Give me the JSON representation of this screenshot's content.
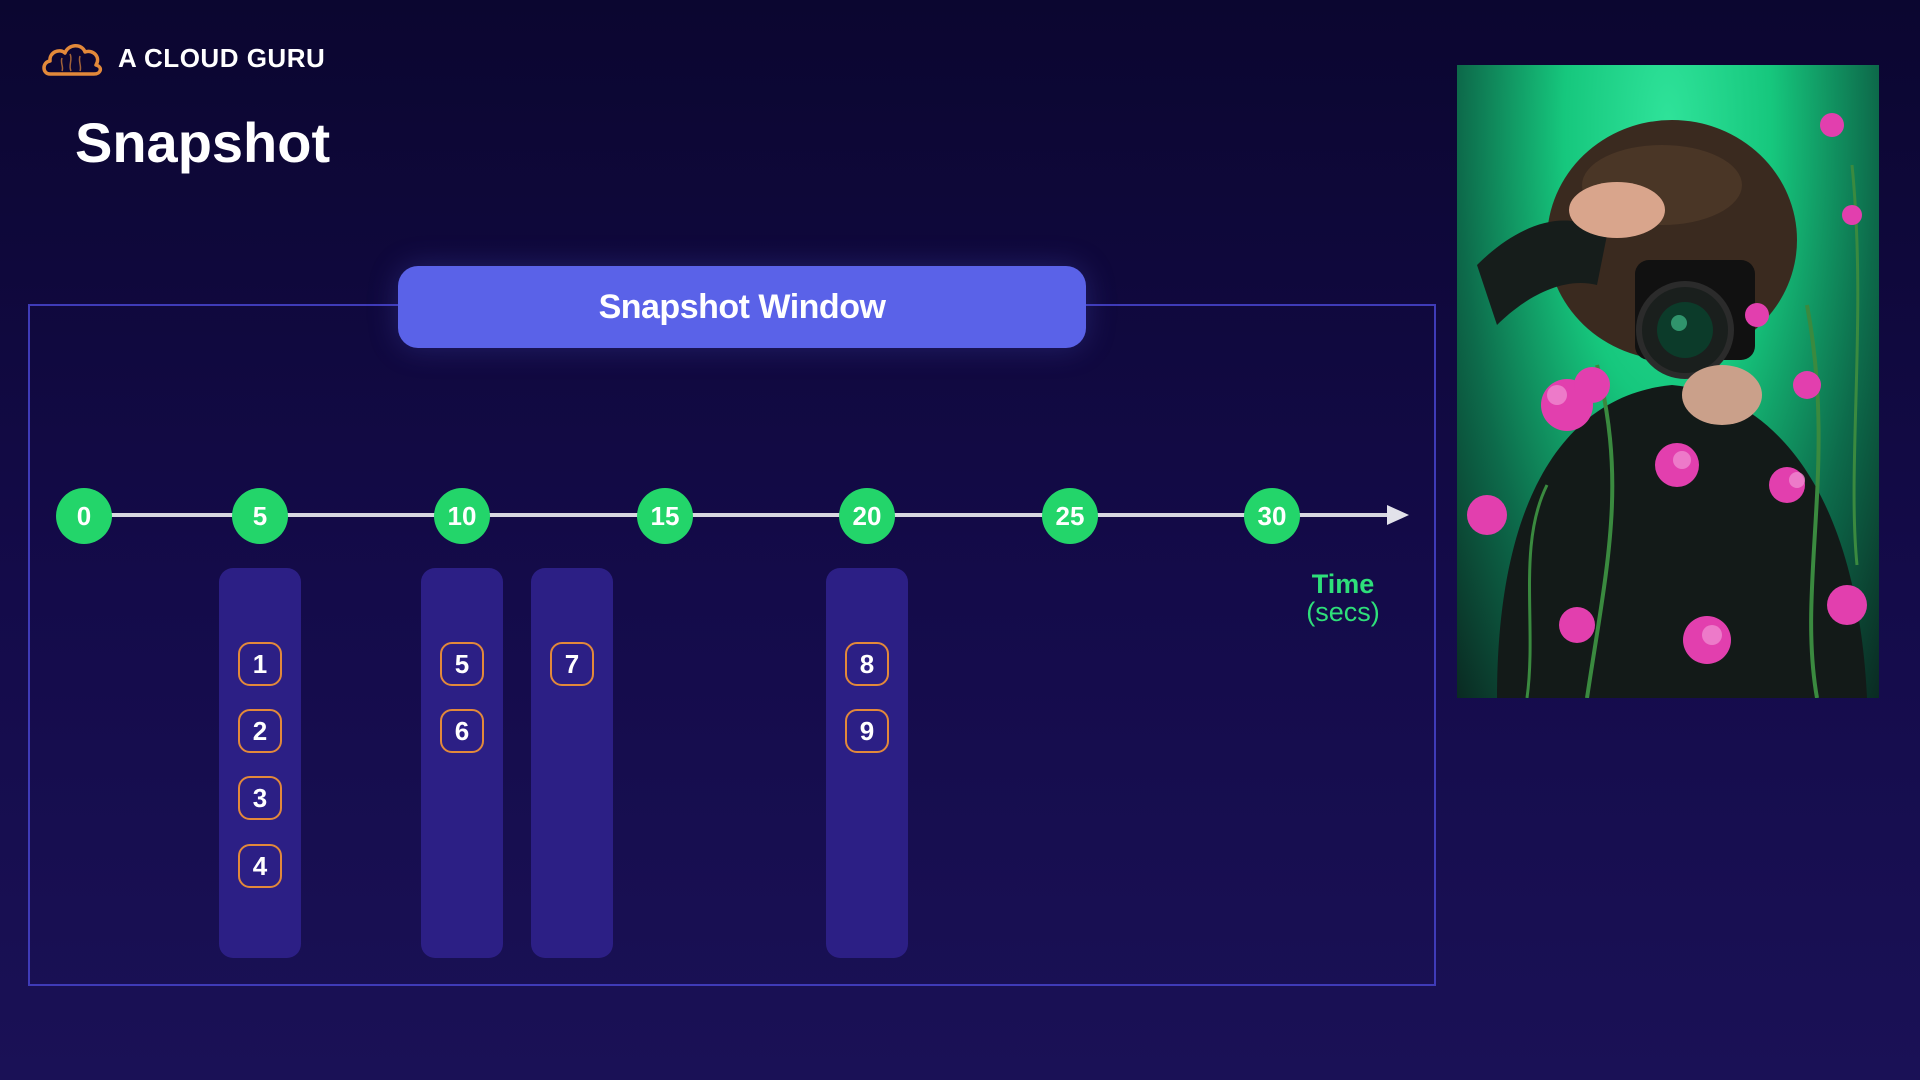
{
  "brand": {
    "name": "A CLOUD GURU",
    "logo_icon": "cloud-logo-icon",
    "logo_color": "#e3893a"
  },
  "title": "Snapshot",
  "window_label": "Snapshot Window",
  "axis": {
    "ticks": [
      "0",
      "5",
      "10",
      "15",
      "20",
      "25",
      "30"
    ],
    "label": "Time",
    "unit": "(secs)",
    "tick_color": "#23d56a"
  },
  "columns": [
    {
      "events": [
        "1",
        "2",
        "3",
        "4"
      ]
    },
    {
      "events": [
        "5",
        "6"
      ]
    },
    {
      "events": [
        "7"
      ]
    },
    {
      "events": [
        "8",
        "9"
      ]
    }
  ],
  "colors": {
    "background": "#0b0630",
    "window_label": "#5a62e8",
    "column": "#2c1f85",
    "event_border": "#e3893a",
    "frame_border": "#3f3bb8"
  },
  "photo": {
    "subject": "photographer-with-camera-in-flowers"
  }
}
